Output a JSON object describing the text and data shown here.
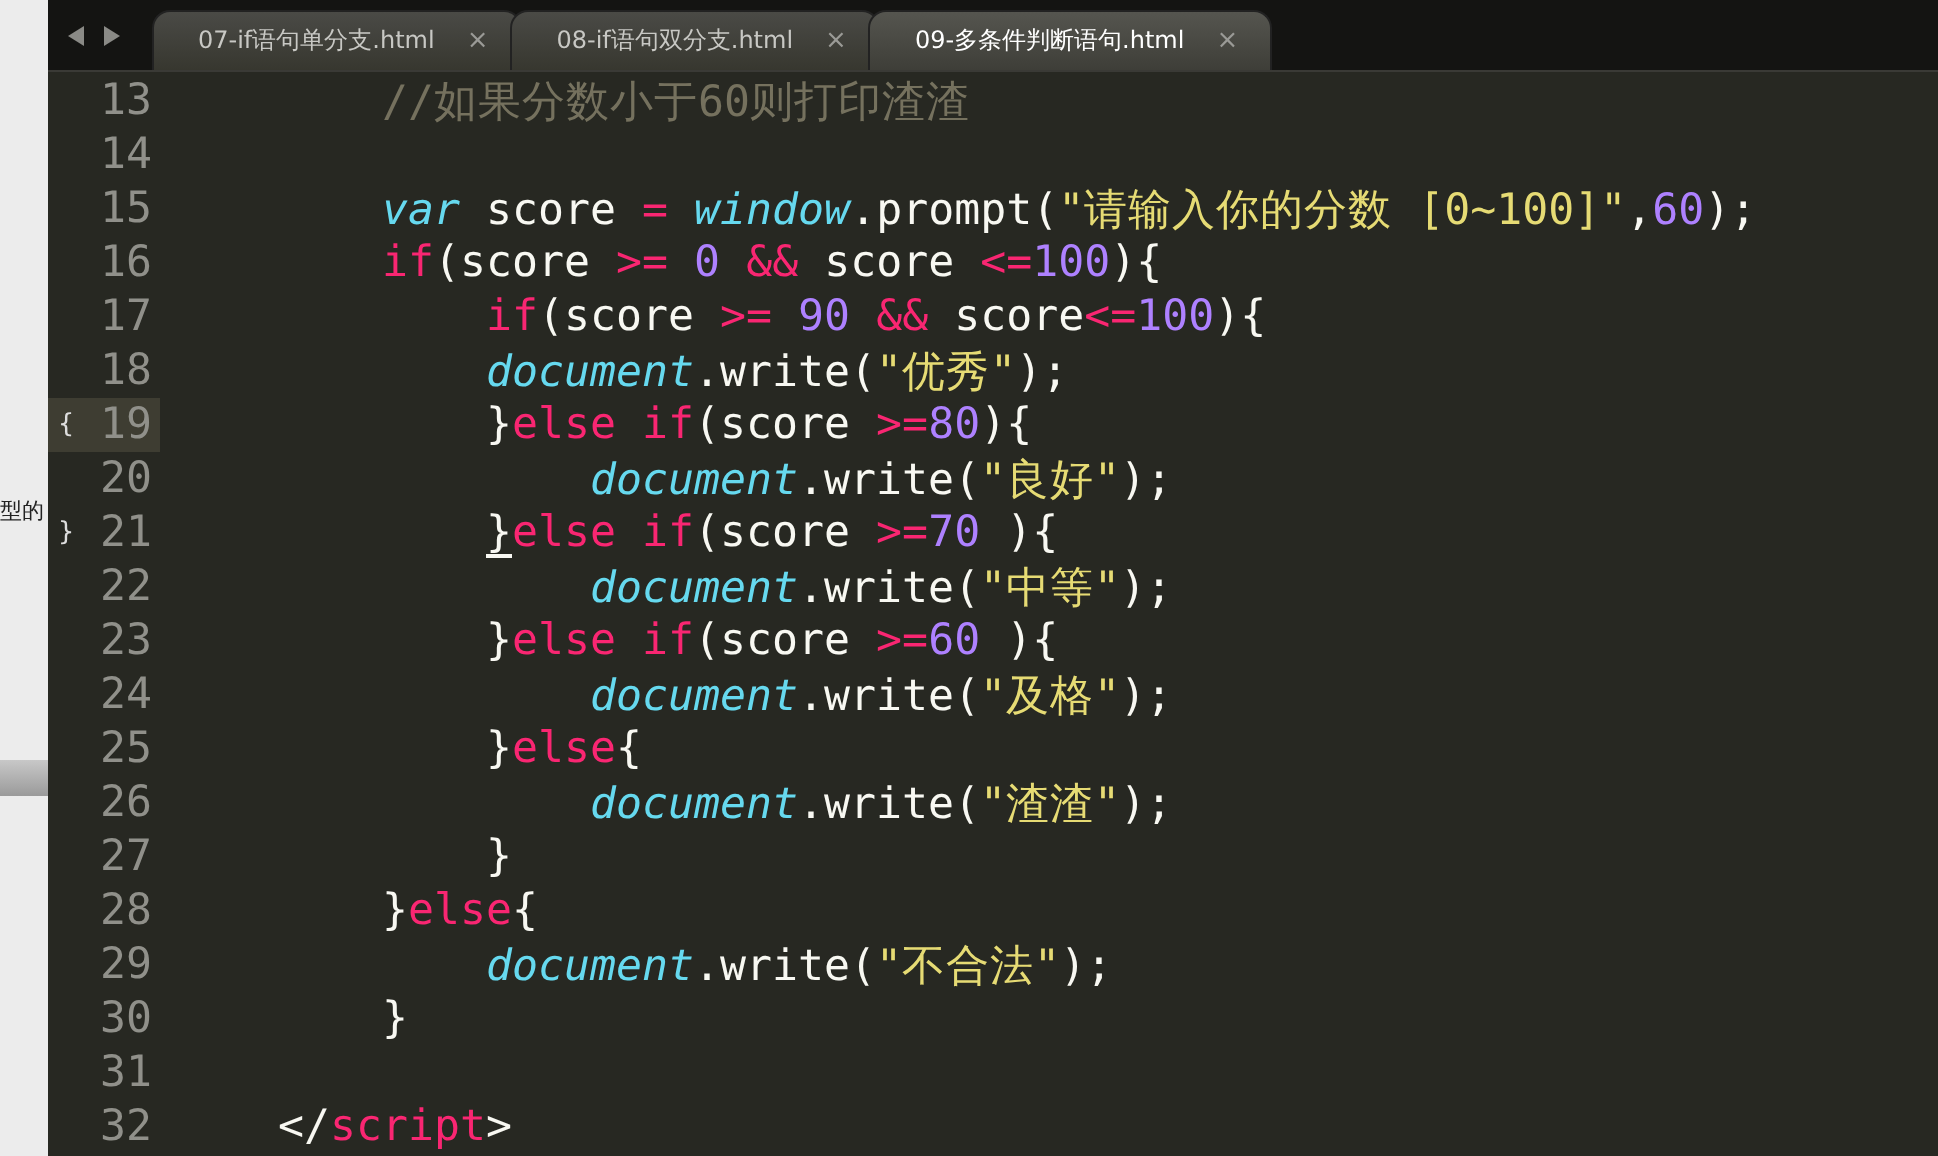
{
  "side_panel": {
    "text": "型的"
  },
  "tab_bar": {
    "tabs": [
      {
        "label": "07-if语句单分支.html",
        "close": "×",
        "selected": false
      },
      {
        "label": "08-if语句双分支.html",
        "close": "×",
        "selected": false
      },
      {
        "label": "09-多条件判断语句.html",
        "close": "×",
        "selected": true
      }
    ]
  },
  "editor": {
    "lines": [
      {
        "number": "13",
        "current": false,
        "tokens": [
          {
            "kind": "comment",
            "text": "        //如果分数小于60则打印渣渣"
          }
        ]
      },
      {
        "number": "14",
        "current": false
      },
      {
        "number": "15",
        "current": false,
        "tokens": [
          {
            "kind": "storage",
            "text": "        var"
          },
          {
            "kind": "plain",
            "text": " score "
          },
          {
            "kind": "op",
            "text": "="
          },
          {
            "kind": "support",
            "text": " window"
          },
          {
            "kind": "plain",
            "text": ".prompt("
          },
          {
            "kind": "string",
            "text": "\"请输入你的分数 [0~100]\""
          },
          {
            "kind": "plain",
            "text": ","
          },
          {
            "kind": "number",
            "text": "60"
          },
          {
            "kind": "plain",
            "text": ");"
          }
        ]
      },
      {
        "number": "16",
        "current": false,
        "tokens": [
          {
            "kind": "keyword",
            "text": "        if"
          },
          {
            "kind": "plain",
            "text": "(score "
          },
          {
            "kind": "op",
            "text": ">="
          },
          {
            "kind": "number",
            "text": " 0"
          },
          {
            "kind": "op",
            "text": " &&"
          },
          {
            "kind": "plain",
            "text": " score "
          },
          {
            "kind": "op",
            "text": "<="
          },
          {
            "kind": "number",
            "text": "100"
          },
          {
            "kind": "plain",
            "text": "){"
          }
        ]
      },
      {
        "number": "17",
        "current": false,
        "tokens": [
          {
            "kind": "keyword",
            "text": "            if"
          },
          {
            "kind": "plain",
            "text": "(score "
          },
          {
            "kind": "op",
            "text": ">="
          },
          {
            "kind": "number",
            "text": " 90"
          },
          {
            "kind": "op",
            "text": " &&"
          },
          {
            "kind": "plain",
            "text": " score"
          },
          {
            "kind": "op",
            "text": "<="
          },
          {
            "kind": "number",
            "text": "100"
          },
          {
            "kind": "plain",
            "text": "){"
          }
        ]
      },
      {
        "number": "18",
        "current": false,
        "tokens": [
          {
            "kind": "support",
            "text": "            document"
          },
          {
            "kind": "plain",
            "text": ".write("
          },
          {
            "kind": "string",
            "text": "\"优秀\""
          },
          {
            "kind": "plain",
            "text": ");"
          }
        ]
      },
      {
        "number": "19",
        "current": true,
        "mark": "{",
        "tokens": [
          {
            "kind": "plain",
            "text": "            }"
          },
          {
            "kind": "keyword",
            "text": "else if"
          },
          {
            "kind": "plain",
            "text": "(score "
          },
          {
            "kind": "op",
            "text": ">="
          },
          {
            "kind": "number",
            "text": "80"
          },
          {
            "kind": "plain",
            "text": "){"
          }
        ]
      },
      {
        "number": "20",
        "current": false,
        "tokens": [
          {
            "kind": "support",
            "text": "                document"
          },
          {
            "kind": "plain",
            "text": ".write("
          },
          {
            "kind": "string",
            "text": "\"良好\""
          },
          {
            "kind": "plain",
            "text": ");"
          }
        ]
      },
      {
        "number": "21",
        "current": false,
        "mark": "}",
        "tokens": [
          {
            "kind": "matched",
            "text": "            }"
          },
          {
            "kind": "keyword",
            "text": "else if"
          },
          {
            "kind": "plain",
            "text": "(score "
          },
          {
            "kind": "op",
            "text": ">="
          },
          {
            "kind": "number",
            "text": "70"
          },
          {
            "kind": "plain",
            "text": " ){"
          }
        ]
      },
      {
        "number": "22",
        "current": false,
        "tokens": [
          {
            "kind": "support",
            "text": "                document"
          },
          {
            "kind": "plain",
            "text": ".write("
          },
          {
            "kind": "string",
            "text": "\"中等\""
          },
          {
            "kind": "plain",
            "text": ");"
          }
        ]
      },
      {
        "number": "23",
        "current": false,
        "tokens": [
          {
            "kind": "plain",
            "text": "            }"
          },
          {
            "kind": "keyword",
            "text": "else if"
          },
          {
            "kind": "plain",
            "text": "(score "
          },
          {
            "kind": "op",
            "text": ">="
          },
          {
            "kind": "number",
            "text": "60"
          },
          {
            "kind": "plain",
            "text": " ){"
          }
        ]
      },
      {
        "number": "24",
        "current": false,
        "tokens": [
          {
            "kind": "support",
            "text": "                document"
          },
          {
            "kind": "plain",
            "text": ".write("
          },
          {
            "kind": "string",
            "text": "\"及格\""
          },
          {
            "kind": "plain",
            "text": ");"
          }
        ]
      },
      {
        "number": "25",
        "current": false,
        "tokens": [
          {
            "kind": "plain",
            "text": "            }"
          },
          {
            "kind": "keyword",
            "text": "else"
          },
          {
            "kind": "plain",
            "text": "{"
          }
        ]
      },
      {
        "number": "26",
        "current": false,
        "tokens": [
          {
            "kind": "support",
            "text": "                document"
          },
          {
            "kind": "plain",
            "text": ".write("
          },
          {
            "kind": "string",
            "text": "\"渣渣\""
          },
          {
            "kind": "plain",
            "text": ");"
          }
        ]
      },
      {
        "number": "27",
        "current": false,
        "tokens": [
          {
            "kind": "plain",
            "text": "            }"
          }
        ]
      },
      {
        "number": "28",
        "current": false,
        "tokens": [
          {
            "kind": "plain",
            "text": "        }"
          },
          {
            "kind": "keyword",
            "text": "else"
          },
          {
            "kind": "plain",
            "text": "{"
          }
        ]
      },
      {
        "number": "29",
        "current": false,
        "tokens": [
          {
            "kind": "support",
            "text": "            document"
          },
          {
            "kind": "plain",
            "text": ".write("
          },
          {
            "kind": "string",
            "text": "\"不合法\""
          },
          {
            "kind": "plain",
            "text": ");"
          }
        ]
      },
      {
        "number": "30",
        "current": false,
        "tokens": [
          {
            "kind": "plain",
            "text": "        }"
          }
        ]
      },
      {
        "number": "31",
        "current": false
      },
      {
        "number": "32",
        "current": false,
        "tokens": [
          {
            "kind": "plain",
            "text": "    </"
          },
          {
            "kind": "keyword",
            "text": "script"
          },
          {
            "kind": "plain",
            "text": ">"
          }
        ]
      }
    ]
  }
}
